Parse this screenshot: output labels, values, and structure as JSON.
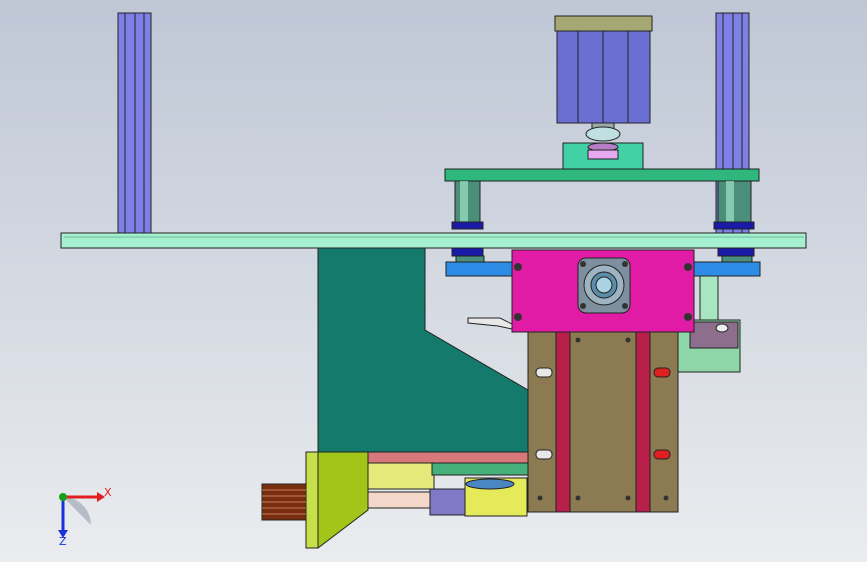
{
  "viewport": {
    "background_top": "#bfc7d6",
    "background_bottom": "#eaecef"
  },
  "triad": {
    "x_label": "X",
    "z_label": "Z",
    "x_color": "#e02020",
    "z_color": "#1a33d6",
    "y_color": "#16a016"
  },
  "parts": [
    {
      "name": "upright-post",
      "color": "#7f80e6"
    },
    {
      "name": "base-plate",
      "color": "#a6f0d0"
    },
    {
      "name": "top-plate",
      "color": "#2fb77d"
    },
    {
      "name": "air-cylinder",
      "color": "#6a6ed2"
    },
    {
      "name": "cylinder-cap",
      "color": "#a6a873"
    },
    {
      "name": "gearbox-housing",
      "color": "#e21ba6"
    },
    {
      "name": "bearing-block",
      "color": "#8c7b52"
    },
    {
      "name": "side-bracket",
      "color": "#137a6c"
    },
    {
      "name": "motor-mount",
      "color": "#a2c51a"
    },
    {
      "name": "drive-pulley",
      "color": "#7a2e10"
    },
    {
      "name": "clamp-ring",
      "color": "#8d6e8c"
    }
  ]
}
